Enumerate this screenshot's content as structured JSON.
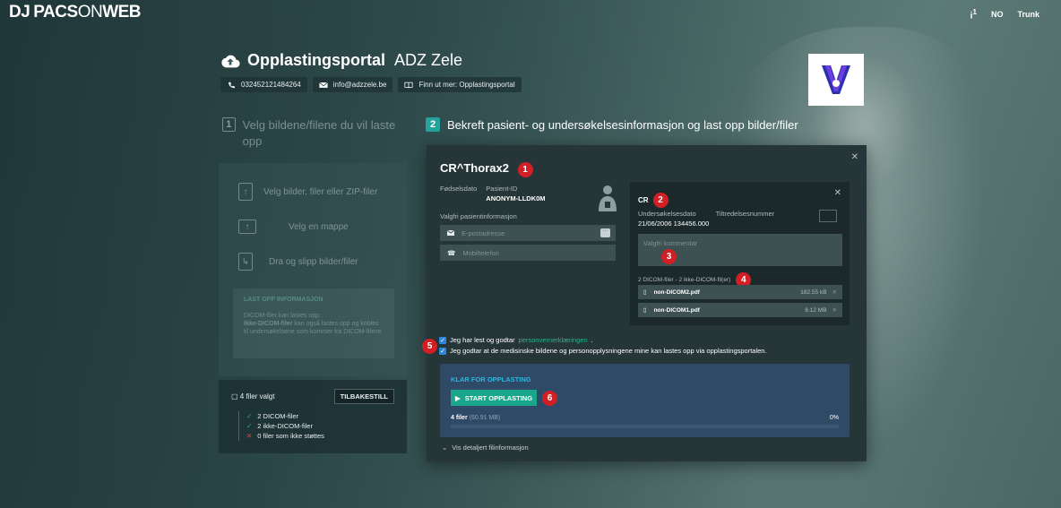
{
  "app": {
    "logo_mark": "DJ",
    "logo_bold1": "PACS",
    "logo_light": "ON",
    "logo_bold2": "WEB",
    "info": "i",
    "info_count": "1",
    "language": "NO",
    "version": "Trunk"
  },
  "portal": {
    "title": "Opplastingsportal",
    "org": "ADZ Zele",
    "phone": "032452121484264",
    "email": "info@adzzele.be",
    "more": "Finn ut mer: Opplastingsportal"
  },
  "step1": {
    "num": "1",
    "label": "Velg bildene/filene du vil laste opp"
  },
  "step2": {
    "num": "2",
    "label": "Bekreft pasient- og undersøkelsesinformasjon og last opp bilder/filer"
  },
  "left": {
    "opt1": "Velg bilder, filer eller ZIP-filer",
    "opt2": "Velg en mappe",
    "opt3": "Dra og slipp bilder/filer",
    "info_title": "LAST OPP INFORMASJON",
    "info_line1": "DICOM-filer kan lastes opp.",
    "info_line2_b": "Ikke-DICOM-filer",
    "info_line2": " kan også lastes opp og kobles til undersøkelsene som kommer fra DICOM-filene.",
    "selected": "4 filer valgt",
    "reset": "TILBAKESTILL",
    "dicom": "2 DICOM-filer",
    "nondicom": "2 ikke-DICOM-filer",
    "unsupported": "0 filer som ikke støttes"
  },
  "patient": {
    "name": "CR^Thorax2",
    "birth_label": "Fødselsdato",
    "id_label": "Pasient-ID",
    "id_value": "ANONYM-LLDK0M",
    "optional_label": "Valgfri pasientinformasjon",
    "email_placeholder": "E-postadresse",
    "phone_placeholder": "Mobiltelefon"
  },
  "study": {
    "modality": "CR",
    "date_label": "Undersøkelsesdato",
    "acc_label": "Tiltredelsesnummer",
    "date_value": "21/06/2006 134456.000",
    "comment_placeholder": "Valgfri kommentar",
    "files_label": "2 DICOM-filer - 2 ikke-DICOM-fil(er)",
    "files": [
      {
        "name": "non-DICOM2.pdf",
        "size": "182.55 kB"
      },
      {
        "name": "non-DICOM1.pdf",
        "size": "6.12 MB"
      }
    ]
  },
  "consent": {
    "line1_a": "Jeg har lest og godtar ",
    "line1_link": "personvernerklæringen",
    "line1_b": ".",
    "line2": "Jeg godtar at de medisinske bildene og personopplysningene mine kan lastes opp via opplastingsportalen."
  },
  "upload": {
    "ready": "KLAR FOR OPPLASTING",
    "button": "START OPPLASTING",
    "count": "4 filer",
    "size": "(60.91 MB)",
    "percent": "0%",
    "progress": 0,
    "details": "Vis detaljert filinformasjon"
  },
  "badges": [
    "1",
    "2",
    "3",
    "4",
    "5",
    "6"
  ],
  "colors": {
    "accent": "#23a39a",
    "badge": "#d21f25",
    "link": "#2bb38f",
    "upload_bg": "#2f4a66",
    "ready": "#29b6e0",
    "button": "#1aa68a"
  }
}
